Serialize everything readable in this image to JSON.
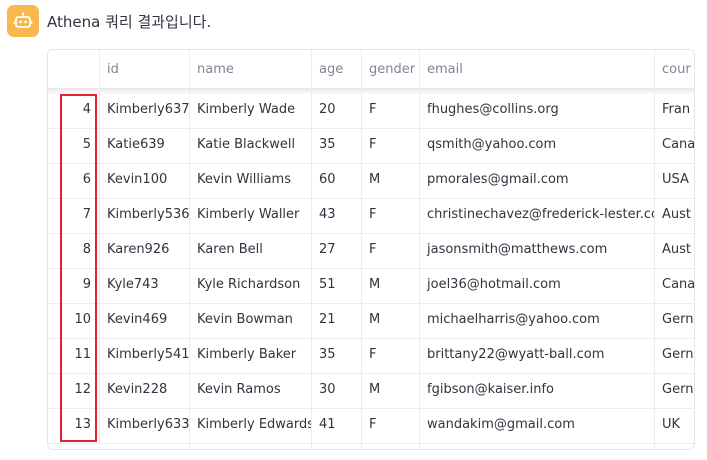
{
  "message": {
    "text": "Athena 쿼리 결과입니다."
  },
  "table": {
    "columns": [
      "id",
      "name",
      "age",
      "gender",
      "email",
      "cour"
    ],
    "rows": [
      {
        "index": "4",
        "id": "Kimberly637",
        "name": "Kimberly Wade",
        "age": "20",
        "gender": "F",
        "email": "fhughes@collins.org",
        "country": "Fran"
      },
      {
        "index": "5",
        "id": "Katie639",
        "name": "Katie Blackwell",
        "age": "35",
        "gender": "F",
        "email": "qsmith@yahoo.com",
        "country": "Cana"
      },
      {
        "index": "6",
        "id": "Kevin100",
        "name": "Kevin Williams",
        "age": "60",
        "gender": "M",
        "email": "pmorales@gmail.com",
        "country": "USA"
      },
      {
        "index": "7",
        "id": "Kimberly536",
        "name": "Kimberly Waller",
        "age": "43",
        "gender": "F",
        "email": "christinechavez@frederick-lester.com",
        "country": "Aust"
      },
      {
        "index": "8",
        "id": "Karen926",
        "name": "Karen Bell",
        "age": "27",
        "gender": "F",
        "email": "jasonsmith@matthews.com",
        "country": "Aust"
      },
      {
        "index": "9",
        "id": "Kyle743",
        "name": "Kyle Richardson",
        "age": "51",
        "gender": "M",
        "email": "joel36@hotmail.com",
        "country": "Cana"
      },
      {
        "index": "10",
        "id": "Kevin469",
        "name": "Kevin Bowman",
        "age": "21",
        "gender": "M",
        "email": "michaelharris@yahoo.com",
        "country": "Gern"
      },
      {
        "index": "11",
        "id": "Kimberly541",
        "name": "Kimberly Baker",
        "age": "35",
        "gender": "F",
        "email": "brittany22@wyatt-ball.com",
        "country": "Gern"
      },
      {
        "index": "12",
        "id": "Kevin228",
        "name": "Kevin Ramos",
        "age": "30",
        "gender": "M",
        "email": "fgibson@kaiser.info",
        "country": "Gern"
      },
      {
        "index": "13",
        "id": "Kimberly633",
        "name": "Kimberly Edwards",
        "age": "41",
        "gender": "F",
        "email": "wandakim@gmail.com",
        "country": "UK"
      }
    ]
  },
  "colors": {
    "avatar": "#f8b84e",
    "highlight_box": "#e3222d"
  },
  "icons": {
    "avatar": "robot-icon"
  }
}
